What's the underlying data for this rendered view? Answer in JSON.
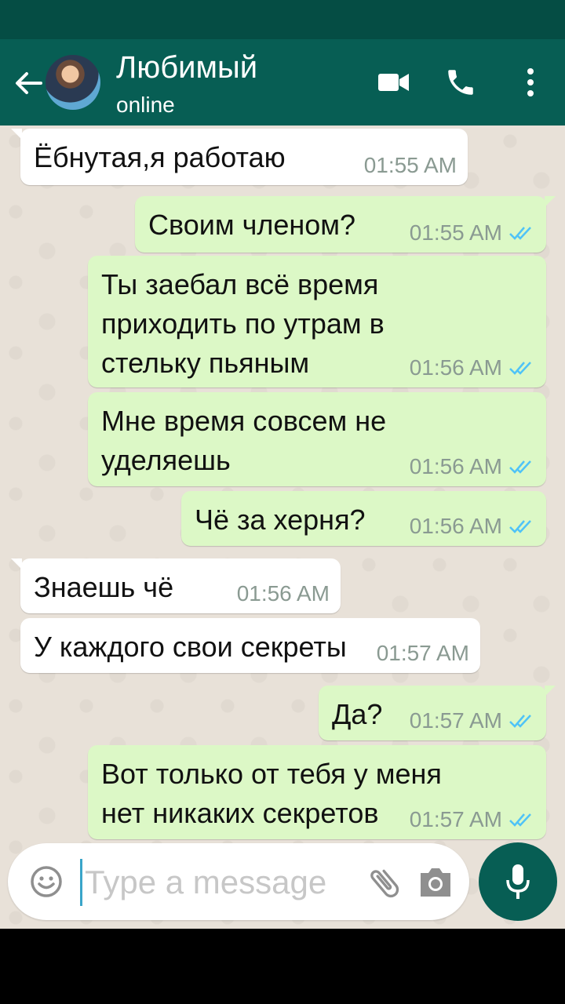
{
  "header": {
    "contact_name": "Любимый",
    "status": "online"
  },
  "colors": {
    "header": "#075e54",
    "outgoing_bubble": "#dcf8c6",
    "incoming_bubble": "#ffffff",
    "read_ticks": "#4fc3f7"
  },
  "messages": [
    {
      "text": "Ёбнутая,я работаю",
      "time": "01:55 AM"
    },
    {
      "text": "Своим членом?",
      "time": "01:55 AM"
    },
    {
      "text": "Ты заебал всё время\nприходить по утрам в\nстельку пьяным",
      "time": "01:56 AM"
    },
    {
      "text": "Мне время совсем не\nуделяешь",
      "time": "01:56 AM"
    },
    {
      "text": "Чё за херня?",
      "time": "01:56 AM"
    },
    {
      "text": "Знаешь чё",
      "time": "01:56 AM"
    },
    {
      "text": "У каждого свои секреты",
      "time": "01:57 AM"
    },
    {
      "text": "Да?",
      "time": "01:57 AM"
    },
    {
      "text": "Вот только от тебя у меня\nнет никаких секретов",
      "time": "01:57 AM"
    }
  ],
  "input": {
    "placeholder": "Type a message"
  }
}
